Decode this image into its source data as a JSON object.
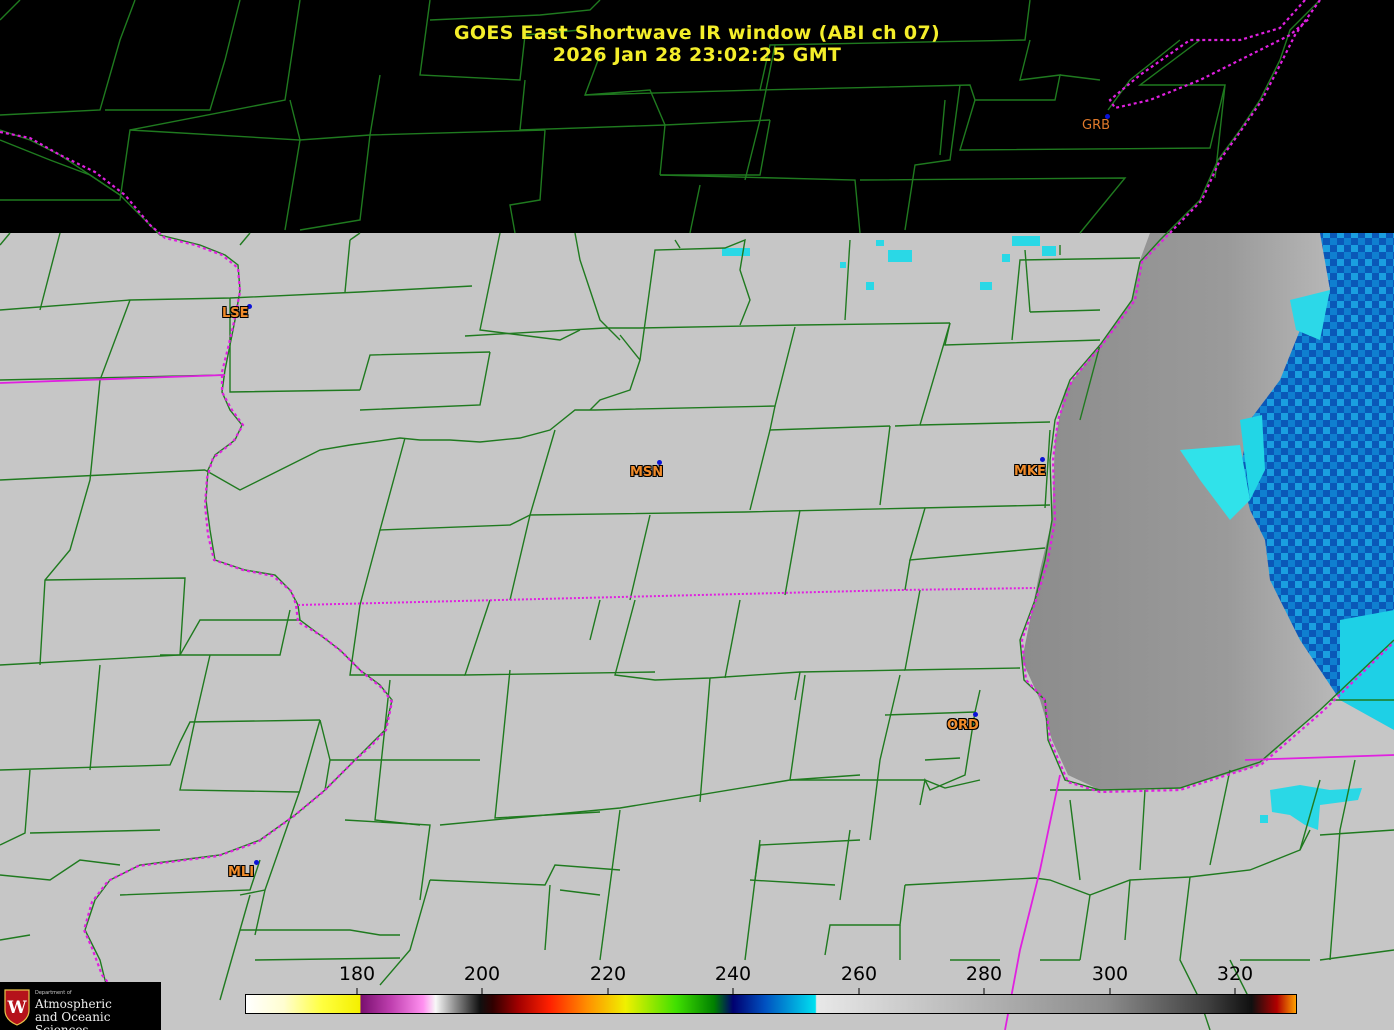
{
  "title": {
    "line1": "GOES East Shortwave IR window (ABI ch 07)",
    "line2": "2026 Jan 28  23:02:25 GMT"
  },
  "stations": [
    {
      "id": "GRB",
      "label": "GRB",
      "style": "top-dark"
    },
    {
      "id": "LSE",
      "label": "LSE",
      "style": "normal"
    },
    {
      "id": "MSN",
      "label": "MSN",
      "style": "normal"
    },
    {
      "id": "MKE",
      "label": "MKE",
      "style": "normal"
    },
    {
      "id": "ORD",
      "label": "ORD",
      "style": "normal"
    },
    {
      "id": "MLI",
      "label": "MLI",
      "style": "normal"
    }
  ],
  "colorbar": {
    "ticks": [
      "180",
      "200",
      "220",
      "240",
      "260",
      "280",
      "300",
      "320"
    ],
    "range": [
      164,
      330
    ]
  },
  "logo": {
    "dept": "Department of",
    "name_line1": "Atmospheric",
    "name_line2": "and Oceanic Sciences",
    "seal_letter": "W"
  },
  "colors": {
    "title": "#f4ee2a",
    "county_lines": "#1f7a1f",
    "state_border": "#e020e0",
    "station_label": "#f08b2a",
    "station_dot": "#0a12d8"
  }
}
